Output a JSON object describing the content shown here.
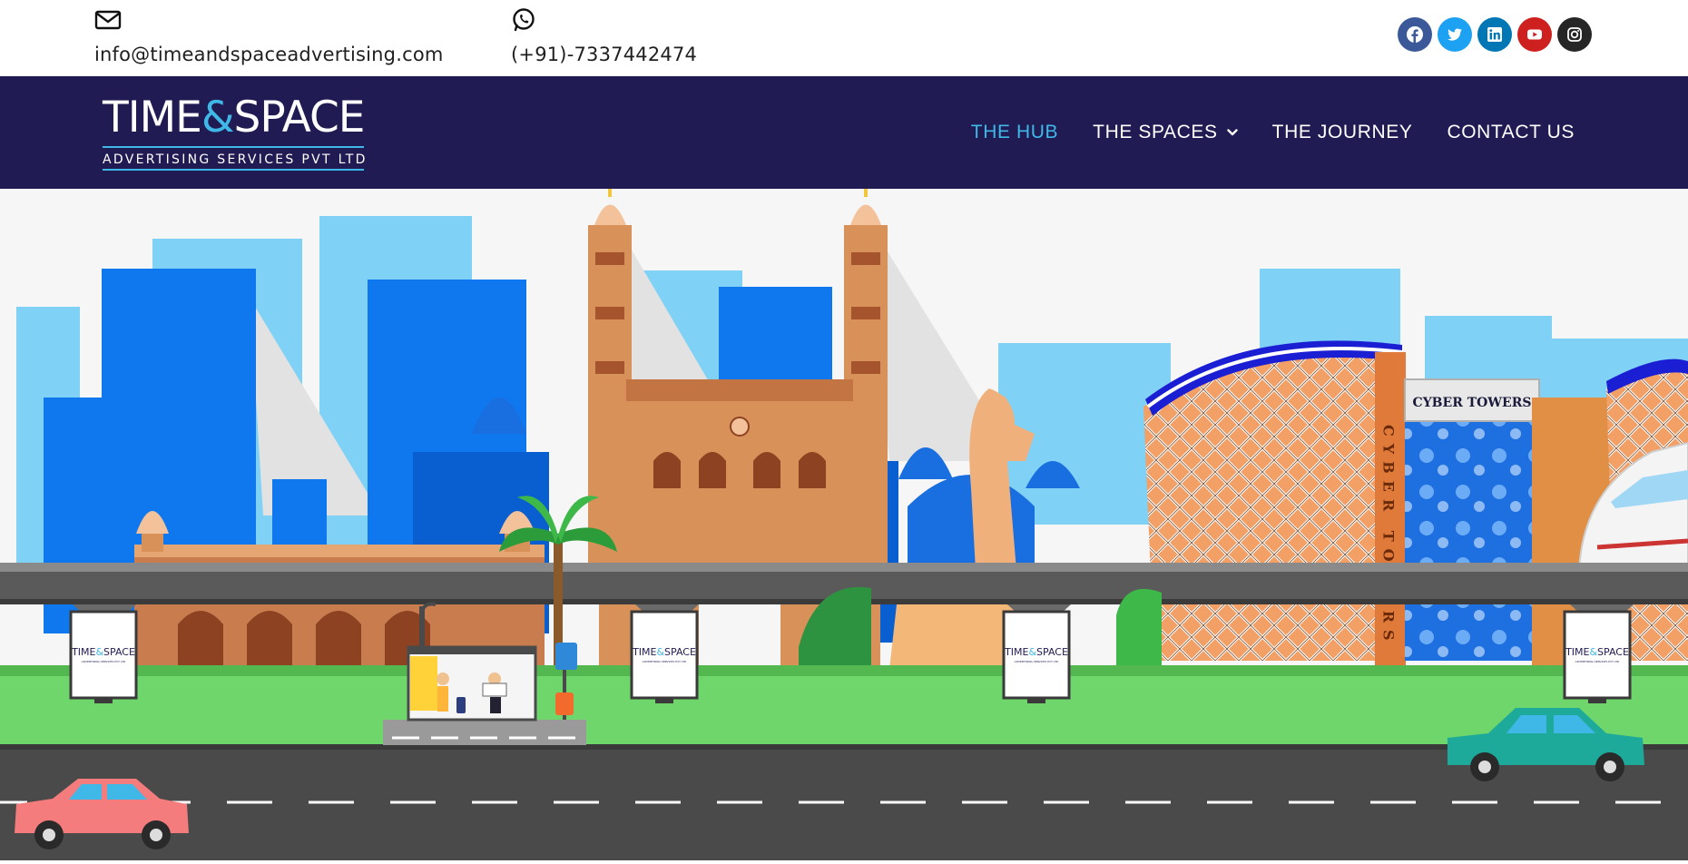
{
  "topbar": {
    "email": "info@timeandspaceadvertising.com",
    "phone": "(+91)-7337442474",
    "email_icon": "envelope-icon",
    "phone_icon": "whatsapp-icon"
  },
  "socials": [
    {
      "name": "facebook",
      "icon": "facebook-icon",
      "color": "#3b5998"
    },
    {
      "name": "twitter",
      "icon": "twitter-icon",
      "color": "#1da1f2"
    },
    {
      "name": "linkedin",
      "icon": "linkedin-icon",
      "color": "#0077b5"
    },
    {
      "name": "youtube",
      "icon": "youtube-icon",
      "color": "#cd201f"
    },
    {
      "name": "instagram",
      "icon": "instagram-icon",
      "color": "#262626"
    }
  ],
  "brand": {
    "word1": "TIME",
    "amp": "&",
    "word2": "SPACE",
    "tagline": "ADVERTISING SERVICES PVT LTD",
    "nav_bg": "#201b53",
    "accent": "#3fb8e8"
  },
  "nav": {
    "items": [
      {
        "label": "THE HUB",
        "active": true
      },
      {
        "label": "THE SPACES",
        "has_dropdown": true
      },
      {
        "label": "THE JOURNEY"
      },
      {
        "label": "CONTACT US"
      }
    ]
  },
  "hero": {
    "tower_sign": "CYBER TOWERS",
    "tower_vertical": "CYBER TOWERS",
    "billboard_word1": "TIME",
    "billboard_amp": "&",
    "billboard_word2": "SPACE",
    "billboard_sub": "ADVERTISING SERVICES PVT LTD"
  }
}
